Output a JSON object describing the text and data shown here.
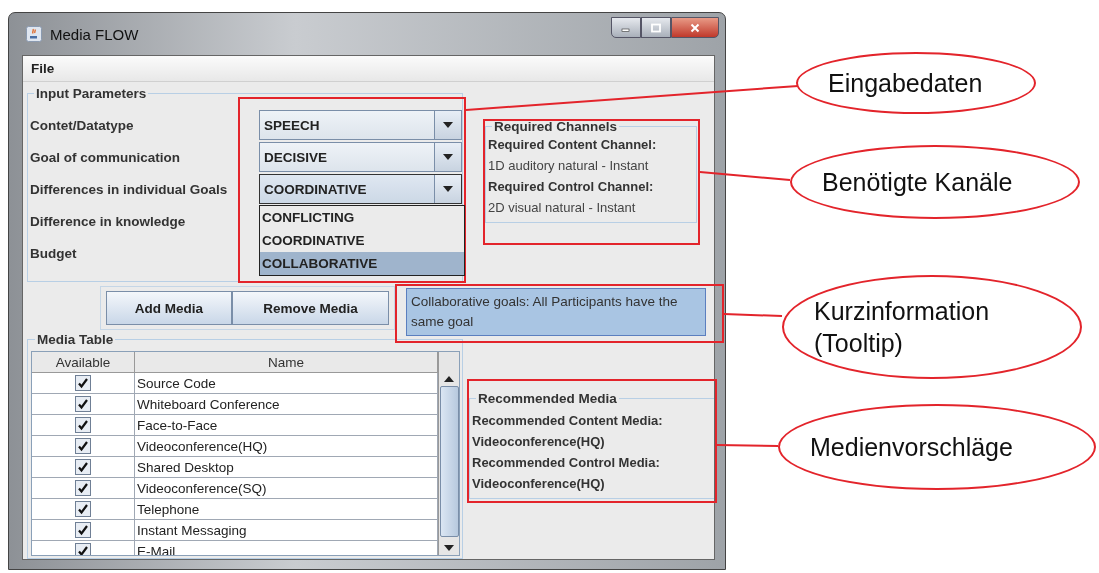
{
  "window": {
    "title": "Media FLOW"
  },
  "menu": [
    "File"
  ],
  "input_parameters": {
    "title": "Input Parameters",
    "rows": [
      {
        "label": "Contet/Datatype",
        "value": "SPEECH",
        "expanded": false
      },
      {
        "label": "Goal of communication",
        "value": "DECISIVE",
        "expanded": false
      },
      {
        "label": "Differences in individual Goals",
        "value": "COORDINATIVE",
        "expanded": true
      },
      {
        "label": "Difference in knowledge"
      },
      {
        "label": "Budget"
      }
    ],
    "dropdown_options": [
      {
        "label": "CONFLICTING",
        "selected": false
      },
      {
        "label": "COORDINATIVE",
        "selected": false
      },
      {
        "label": "COLLABORATIVE",
        "selected": true
      }
    ]
  },
  "buttons": [
    "Add Media",
    "Remove Media"
  ],
  "media_table": {
    "title": "Media Table",
    "columns": [
      "Available",
      "Name"
    ],
    "rows": [
      {
        "available": true,
        "name": "Source Code"
      },
      {
        "available": true,
        "name": "Whiteboard Conference"
      },
      {
        "available": true,
        "name": "Face-to-Face"
      },
      {
        "available": true,
        "name": "Videoconference(HQ)"
      },
      {
        "available": true,
        "name": "Shared Desktop"
      },
      {
        "available": true,
        "name": "Videoconference(SQ)"
      },
      {
        "available": true,
        "name": "Telephone"
      },
      {
        "available": true,
        "name": "Instant Messaging"
      },
      {
        "available": true,
        "name": "E-Mail"
      }
    ]
  },
  "required_channels": {
    "title": "Required Channels",
    "items": [
      {
        "label": "Required Content Channel:",
        "value": "1D auditory natural - Instant"
      },
      {
        "label": "Required Control Channel:",
        "value": "2D visual natural - Instant"
      }
    ]
  },
  "tooltip": "Collaborative goals: All Participants have the same goal",
  "recommended_media": {
    "title": "Recommended Media",
    "items": [
      {
        "label": "Recommended Content Media:",
        "value": "Videoconference(HQ)"
      },
      {
        "label": "Recommended Control Media:",
        "value": "Videoconference(HQ)"
      }
    ]
  },
  "annotations": [
    {
      "label": "Eingabedaten"
    },
    {
      "label": "Benötigte Kanäle"
    },
    {
      "label": "Kurzinformation (Tooltip)"
    },
    {
      "label": "Medienvorschläge"
    }
  ]
}
